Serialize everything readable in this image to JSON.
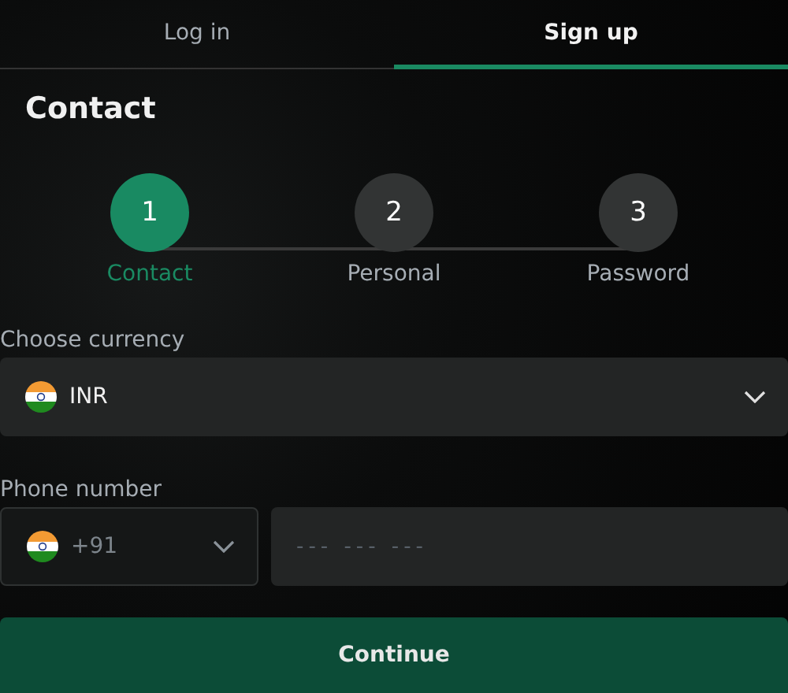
{
  "tabs": [
    {
      "label": "Log in",
      "selected": false
    },
    {
      "label": "Sign up",
      "selected": true
    }
  ],
  "title": "Contact",
  "steps": [
    {
      "number": "1",
      "label": "Contact",
      "selected": true
    },
    {
      "number": "2",
      "label": "Personal",
      "selected": false
    },
    {
      "number": "3",
      "label": "Password",
      "selected": false
    }
  ],
  "currency": {
    "label": "Choose currency",
    "value": "INR"
  },
  "phone": {
    "label": "Phone number",
    "code": "+91",
    "placeholder": "--- --- ---"
  },
  "buttons": [
    "Continue"
  ]
}
